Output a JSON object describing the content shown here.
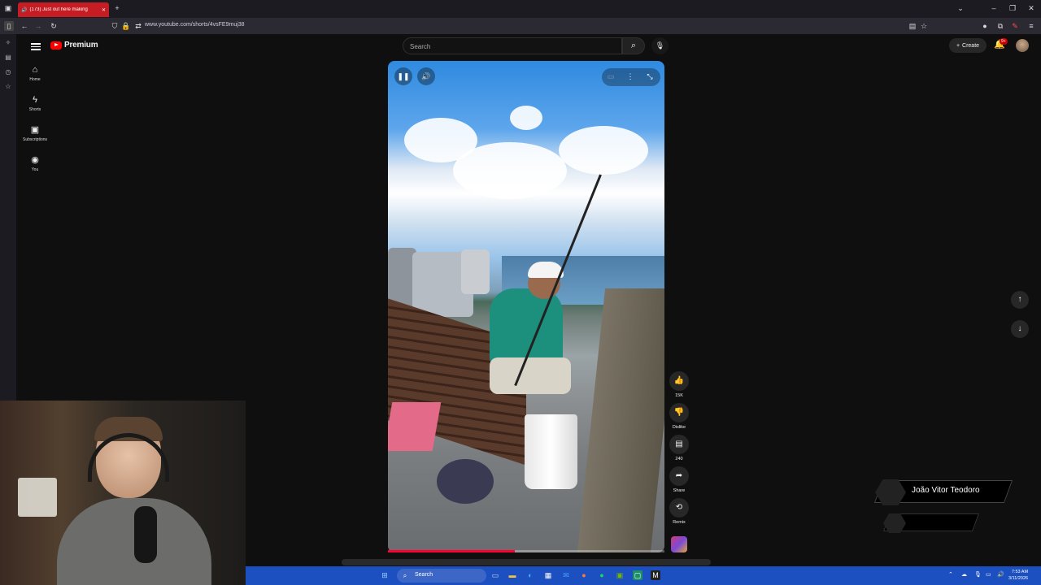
{
  "browser": {
    "tab_title": "(173) Just out here making",
    "url": "www.youtube.com/shorts/4vsFE9muj38"
  },
  "youtube": {
    "logo_text": "Premium",
    "search_placeholder": "Search",
    "create_label": "Create",
    "notification_badge": "9+",
    "nav": [
      {
        "label": "Home",
        "icon": "home-icon"
      },
      {
        "label": "Shorts",
        "icon": "shorts-icon"
      },
      {
        "label": "Subscriptions",
        "icon": "subscriptions-icon"
      },
      {
        "label": "You",
        "icon": "you-icon"
      }
    ]
  },
  "short": {
    "progress_fraction": 0.46,
    "actions": {
      "like_count": "15K",
      "dislike_label": "Dislike",
      "comment_count": "240",
      "share_label": "Share",
      "remix_label": "Remix"
    }
  },
  "overlay": {
    "name": "João Vitor Teodoro"
  },
  "taskbar": {
    "search_label": "Search",
    "time": "7:53 AM",
    "date": "3/11/2026"
  },
  "colors": {
    "tab_red": "#c51d23",
    "yt_red": "#ff0000",
    "progress_red": "#ff0033",
    "taskbar_blue": "#1c4fbf"
  }
}
